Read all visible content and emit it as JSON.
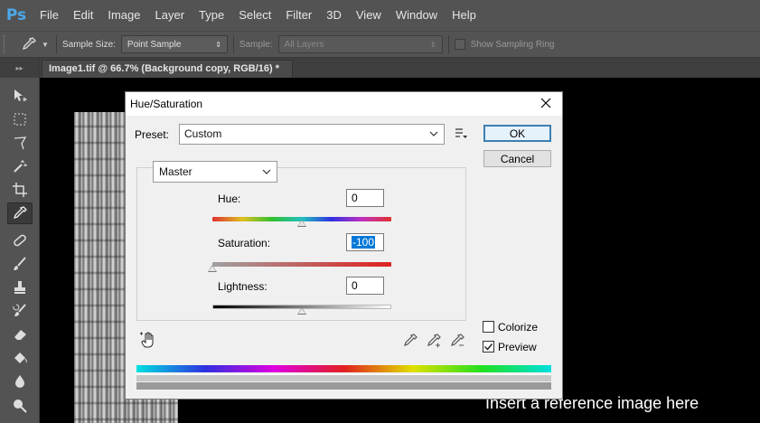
{
  "app": {
    "logo": "Ps"
  },
  "menu": [
    "File",
    "Edit",
    "Image",
    "Layer",
    "Type",
    "Select",
    "Filter",
    "3D",
    "View",
    "Window",
    "Help"
  ],
  "options_bar": {
    "sample_size_label": "Sample Size:",
    "sample_size_value": "Point Sample",
    "sample_label": "Sample:",
    "sample_value": "All Layers",
    "sampling_ring_label": "Show Sampling Ring"
  },
  "tool_panel": {
    "collapse_glyph": "▸▸"
  },
  "document_tab": {
    "title": "Image1.tif @ 66.7% (Background copy, RGB/16) *"
  },
  "canvas": {
    "watermark": "Insert a reference image here"
  },
  "dialog": {
    "title": "Hue/Saturation",
    "preset_label": "Preset:",
    "preset_value": "Custom",
    "ok_label": "OK",
    "cancel_label": "Cancel",
    "channel_value": "Master",
    "hue_label": "Hue:",
    "hue_value": "0",
    "saturation_label": "Saturation:",
    "saturation_value": "-100",
    "lightness_label": "Lightness:",
    "lightness_value": "0",
    "colorize_label": "Colorize",
    "colorize_checked": false,
    "preview_label": "Preview",
    "preview_checked": true
  },
  "icons": {
    "eyedropper": "eyedropper-icon",
    "close": "close-icon",
    "preset_menu": "preset-options-icon",
    "hand": "on-image-adjustment-icon",
    "dropper": "eyedropper-icon",
    "dropper_add": "eyedropper-add-icon",
    "dropper_subtract": "eyedropper-subtract-icon"
  },
  "colors": {
    "menubar": "#535353",
    "accent": "#4aa8ec",
    "ok_border": "#3c7fb1"
  }
}
